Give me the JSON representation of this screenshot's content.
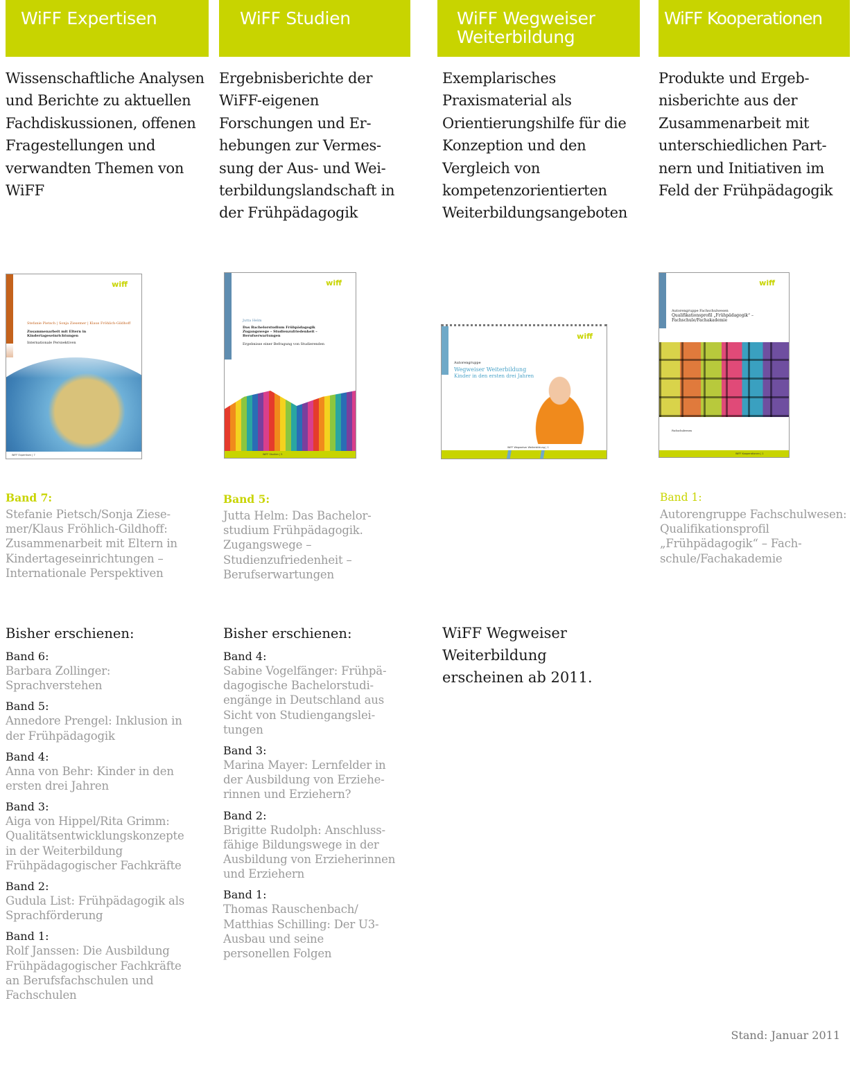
{
  "columns": [
    {
      "header": "WiFF Expertisen",
      "description": "Wissenschaftliche Analysen und Berichte zu aktuellen Fachdis­kussionen, offenen Fragestellungen und verwandten Themen von WiFF",
      "cover": {
        "logo": "wiff",
        "authors": "Stefanie Pietsch | Sonja Ziesemer | Klaus Fröhlich-Gildhoff",
        "title": "Zusammenarbeit mit Eltern in Kindertageseinrichtungen",
        "subtitle": "Internationale Perspektiven",
        "footer": "WiFF Expertisen | 7",
        "colors": {
          "strip": "#c4621c",
          "sea": "#4a8fc0",
          "land": "#d9c27a"
        }
      },
      "band": {
        "label": "Band 7:",
        "text": "Stefanie Pietsch/Sonja Ziese­mer/Klaus Fröhlich-Gildhoff: Zusammenarbeit mit Eltern in Kindertageseinrichtungen – Internationale Perspektiven"
      },
      "bisher_title": "Bisher erschienen:",
      "bisher": [
        {
          "label": "Band 6:",
          "text": "Barbara Zollinger: Sprachverstehen"
        },
        {
          "label": "Band 5:",
          "text": "Annedore Prengel: Inklusion in der Frühpädagogik"
        },
        {
          "label": "Band 4:",
          "text": "Anna von Behr: Kinder in den ersten drei Jahren"
        },
        {
          "label": "Band 3:",
          "text": "Aiga von Hippel/Rita Grimm: Qualitätsentwicklungskon­zepte in der Weiterbildung Frühpädagogischer Fach­kräfte"
        },
        {
          "label": "Band 2:",
          "text": "Gudula List: Frühpädagogik als Sprachförderung"
        },
        {
          "label": "Band 1:",
          "text": "Rolf Janssen: Die Ausbildung Frühpädagogischer Fach­kräfte an Berufsfachschulen und Fachschulen"
        }
      ]
    },
    {
      "header": "WiFF Studien",
      "description": "Ergebnisberichte der WiFF-eigenen Forschungen und Er­hebungen zur Vermes­sung der Aus- und Wei­terbildungslandschaft in der Frühpädagogik",
      "cover": {
        "logo": "wiff",
        "authors": "Jutta Helm",
        "title": "Das Bachelorstudium Frühpädagogik Zugangswege – Studienzufriedenheit – Berufserwartungen",
        "subtitle": "Ergebnisse einer Befragung von Studierenden",
        "footer": "WiFF Studien | 5",
        "colors": {
          "strip": "#5f8db0"
        }
      },
      "band": {
        "label": "Band 5:",
        "text": "Jutta Helm: Das Bachelor­studium Frühpädagogik. Zugangswege – Studienzufriedenheit – Berufserwartungen"
      },
      "bisher_title": "Bisher erschienen:",
      "bisher": [
        {
          "label": "Band 4:",
          "text": "Sabine Vogelfänger: Frühpä­dagogische Bachelorstudi­engänge in Deutschland aus Sicht von Studiengangslei­tungen"
        },
        {
          "label": "Band 3:",
          "text": "Marina Mayer: Lernfelder in der Ausbildung von Erziehe­rinnen und Erziehern?"
        },
        {
          "label": "Band 2:",
          "text": "Brigitte Rudolph: Anschluss­fähige Bildungswege in der Ausbildung von Erzieherin­nen und Erziehern"
        },
        {
          "label": "Band 1:",
          "text": "Thomas Rauschenbach/ Matthias Schilling: Der U3-Ausbau und seine personellen Folgen"
        }
      ]
    },
    {
      "header": "WiFF Wegweiser Weiterbildung",
      "description": "Exemplarisches Praxismaterial als Orientierungshilfe für die Konzeption und den Vergleich von kompetenzorientierten Weiterbildungsange­boten",
      "cover": {
        "logo": "wiff",
        "authors": "Autorengruppe",
        "title": "Wegweiser Weiterbildung",
        "subtitle": "Kinder in den ersten drei Jahren",
        "footer": "WiFF Wegweiser Weiterbildung | 1",
        "colors": {
          "strip": "#6fa9c8",
          "title": "#4aa3c8"
        }
      },
      "note": "WiFF Wegweiser Weiterbildung erscheinen ab 2011."
    },
    {
      "header": "WiFF Kooperationen",
      "description": "Produkte und Ergeb­nisberichte aus der Zusammenarbeit mit unterschiedlichen Part­nern und Initiativen im Feld der Frühpädagogik",
      "cover": {
        "logo": "wiff",
        "authors": "Autorengruppe Fachschulwesen",
        "title": "Qualifikationsprofil „Frühpädagogik“ – Fachschule/Fachakademie",
        "subtitle": "Fachschulwesen",
        "footer": "WiFF Kooperationen | 1",
        "colors": {
          "strip": "#5f8db0"
        }
      },
      "band": {
        "label": "Band 1:",
        "text": "Autorengruppe Fachschul­wesen: Qualifikationsprofil „Frühpädagogik“ – Fach­schule/Fachakademie"
      }
    }
  ],
  "footer": {
    "stand": "Stand: Januar 2011"
  },
  "colors": {
    "accent": "#c8d400",
    "muted_text": "#9a9a9a",
    "body_text": "#1a1a1a"
  }
}
